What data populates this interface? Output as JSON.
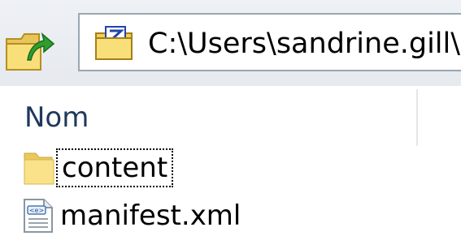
{
  "address_bar": {
    "path": "C:\\Users\\sandrine.gill\\",
    "up_icon": "up-folder-icon",
    "location_icon": "zip-folder-icon"
  },
  "columns": {
    "name_header": "Nom"
  },
  "files": [
    {
      "name": "content",
      "icon": "folder-icon",
      "focused": true
    },
    {
      "name": "manifest.xml",
      "icon": "xml-file-icon",
      "focused": false
    }
  ],
  "colors": {
    "header_text": "#1e395b",
    "folder_fill": "#f8df7a",
    "chrome_bg": "#eef1f5"
  }
}
